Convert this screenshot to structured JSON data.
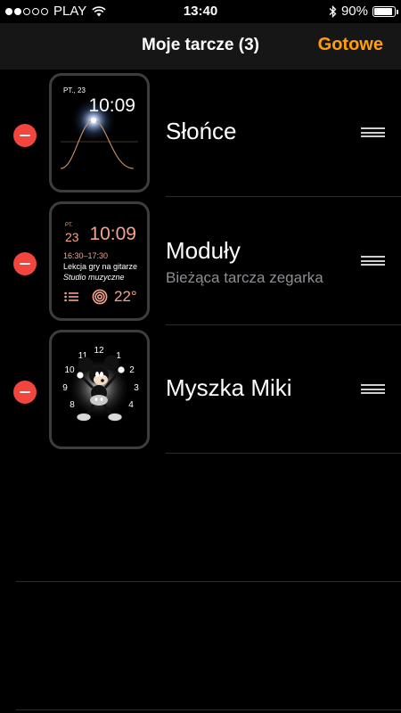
{
  "status_bar": {
    "signal_full": 2,
    "signal_total": 5,
    "carrier": "PLAY",
    "time": "13:40",
    "battery_percent": "90%",
    "battery_level": 0.9,
    "icons": [
      "wifi-icon",
      "bluetooth-icon",
      "battery-icon"
    ]
  },
  "nav": {
    "title": "Moje tarcze (3)",
    "done_label": "Gotowe"
  },
  "colors": {
    "accent": "#ff9f0a",
    "remove": "#f1453d",
    "modular_accent": "#f5a38a"
  },
  "faces": [
    {
      "name": "Słońce",
      "subtitle": "",
      "preview": {
        "date": "PT., 23",
        "time": "10:09"
      }
    },
    {
      "name": "Moduły",
      "subtitle": "Bieżąca tarcza zegarka",
      "preview": {
        "day": "PT.",
        "date": "23",
        "time": "10:09",
        "event_time": "16:30–17:30",
        "event_title": "Lekcja gry na gitarze",
        "event_location": "Studio muzyczne",
        "temperature": "22°"
      }
    },
    {
      "name": "Myszka Miki",
      "subtitle": "",
      "preview": {
        "numbers": [
          "12",
          "1",
          "2",
          "3",
          "4",
          "8",
          "9",
          "10",
          "11"
        ]
      }
    }
  ]
}
